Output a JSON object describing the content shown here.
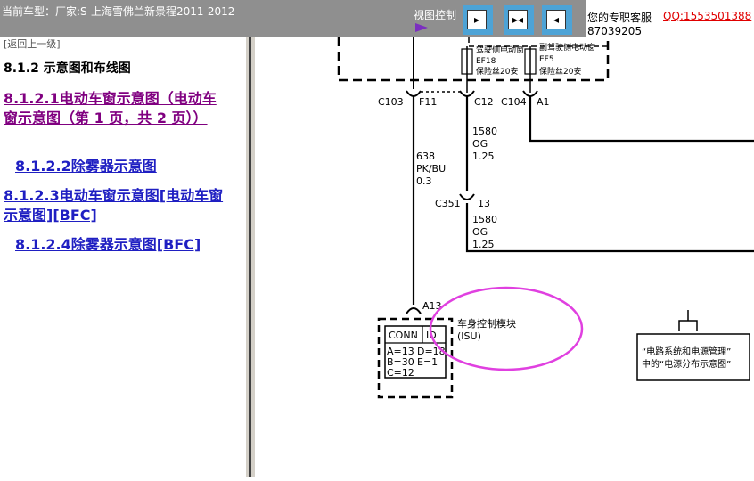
{
  "header": {
    "title": "当前车型：厂家:S-上海雪佛兰新景程2011-2012",
    "view_control_label": "视图控制",
    "view_buttons": [
      {
        "name": "expand-right",
        "glyph": "▸"
      },
      {
        "name": "collapse-center",
        "glyph": "▸◂"
      },
      {
        "name": "expand-left",
        "glyph": "◂"
      }
    ]
  },
  "support": {
    "label": "您的专职客服",
    "qq": "QQ:1553501388",
    "phone": "87039205"
  },
  "nav": {
    "back_link": "[返回上一级]",
    "section_title": "8.1.2 示意图和布线图",
    "items": [
      {
        "label": "8.1.2.1电动车窗示意图（电动车窗示意图（第 1 页，共 2 页））",
        "visited": true
      },
      {
        "label": "8.1.2.2除雾器示意图",
        "visited": false
      },
      {
        "label": "8.1.2.3电动车窗示意图[电动车窗示意图][BFC]",
        "visited": false
      },
      {
        "label": "8.1.2.4除雾器示意图[BFC]",
        "visited": false
      }
    ]
  },
  "diagram": {
    "fuse_labels": [
      {
        "title": "驾驶侧电动窗",
        "fuse": "EF18",
        "rating": "保险丝20安"
      },
      {
        "title": "副驾驶侧电动窗",
        "fuse": "EF5",
        "rating": "保险丝20安"
      }
    ],
    "connectors": [
      "C103",
      "F11",
      "C12",
      "C104",
      "A1",
      "C351",
      "13",
      "A13"
    ],
    "wires": [
      {
        "circuit": "638",
        "color": "PK/BU",
        "size": "0.3"
      },
      {
        "circuit": "1580",
        "color": "OG",
        "size": "1.25"
      },
      {
        "circuit": "1580",
        "color": "OG",
        "size": "1.25"
      }
    ],
    "module": {
      "name": "车身控制模块",
      "abbr": "(ISU)",
      "conn_label": "CONN",
      "id_label": "ID",
      "pins": [
        "A=13",
        "D=18",
        "B=30",
        "E=1",
        "C=12"
      ]
    },
    "reference_box": {
      "line1": "“电路系统和电源管理”",
      "line2": "中的“电源分布示意图”"
    },
    "highlight_color": "#e040e0"
  }
}
